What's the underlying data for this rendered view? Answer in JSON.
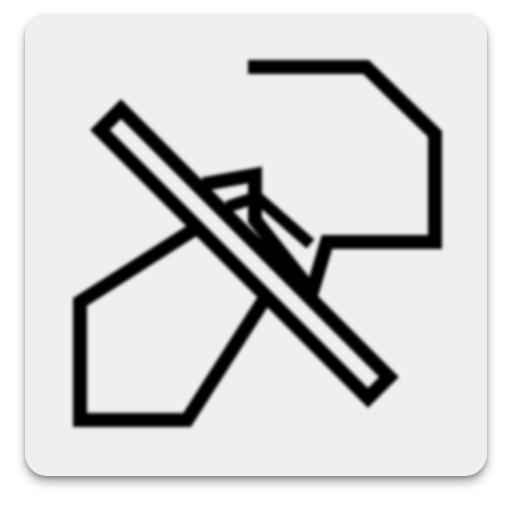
{
  "icon": {
    "name": "disabled-tool-icon",
    "background_color": "#efefef",
    "stroke_color": "#000000"
  }
}
